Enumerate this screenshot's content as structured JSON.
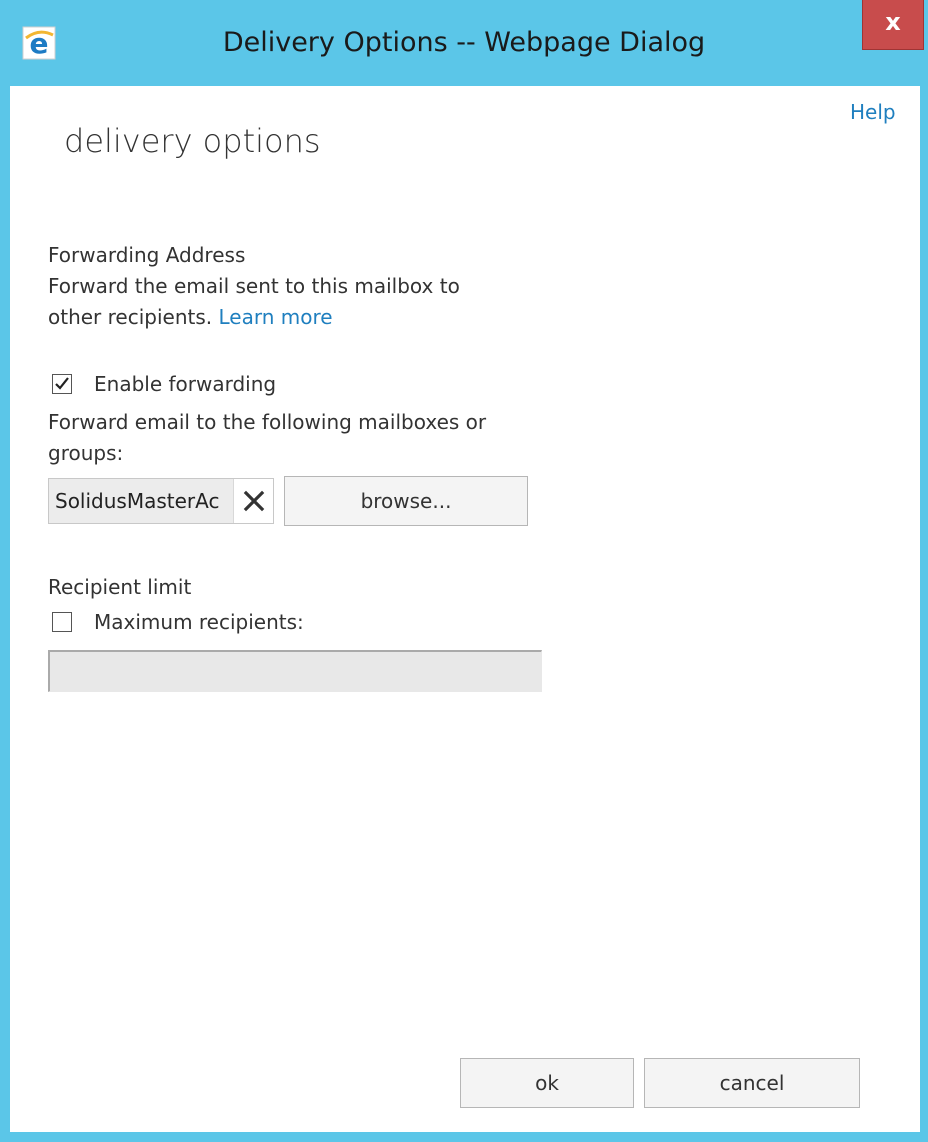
{
  "window": {
    "title": "Delivery Options -- Webpage Dialog",
    "close_label": "x",
    "titlebar_color": "#5bc6e8",
    "close_color": "#c84c4c"
  },
  "header": {
    "help_label": "Help",
    "heading": "delivery options"
  },
  "forwarding": {
    "section_title": "Forwarding Address",
    "description_line1": "Forward the email sent to this mailbox to",
    "description_line2": "other recipients.",
    "learn_more": "Learn more",
    "enable_label": "Enable forwarding",
    "enable_checked": true,
    "target_label_line1": "Forward email to the following mailboxes or",
    "target_label_line2": "groups:",
    "recipient_chip": "SolidusMasterAc",
    "browse_label": "browse..."
  },
  "recipient_limit": {
    "section_title": "Recipient limit",
    "max_label": "Maximum recipients:",
    "max_checked": false,
    "max_value": ""
  },
  "footer": {
    "ok_label": "ok",
    "cancel_label": "cancel"
  },
  "icons": {
    "app": "internet-explorer-icon",
    "close": "close-icon",
    "remove": "remove-x-icon",
    "check": "checkmark-icon"
  },
  "accent_link_color": "#1f7fbf"
}
